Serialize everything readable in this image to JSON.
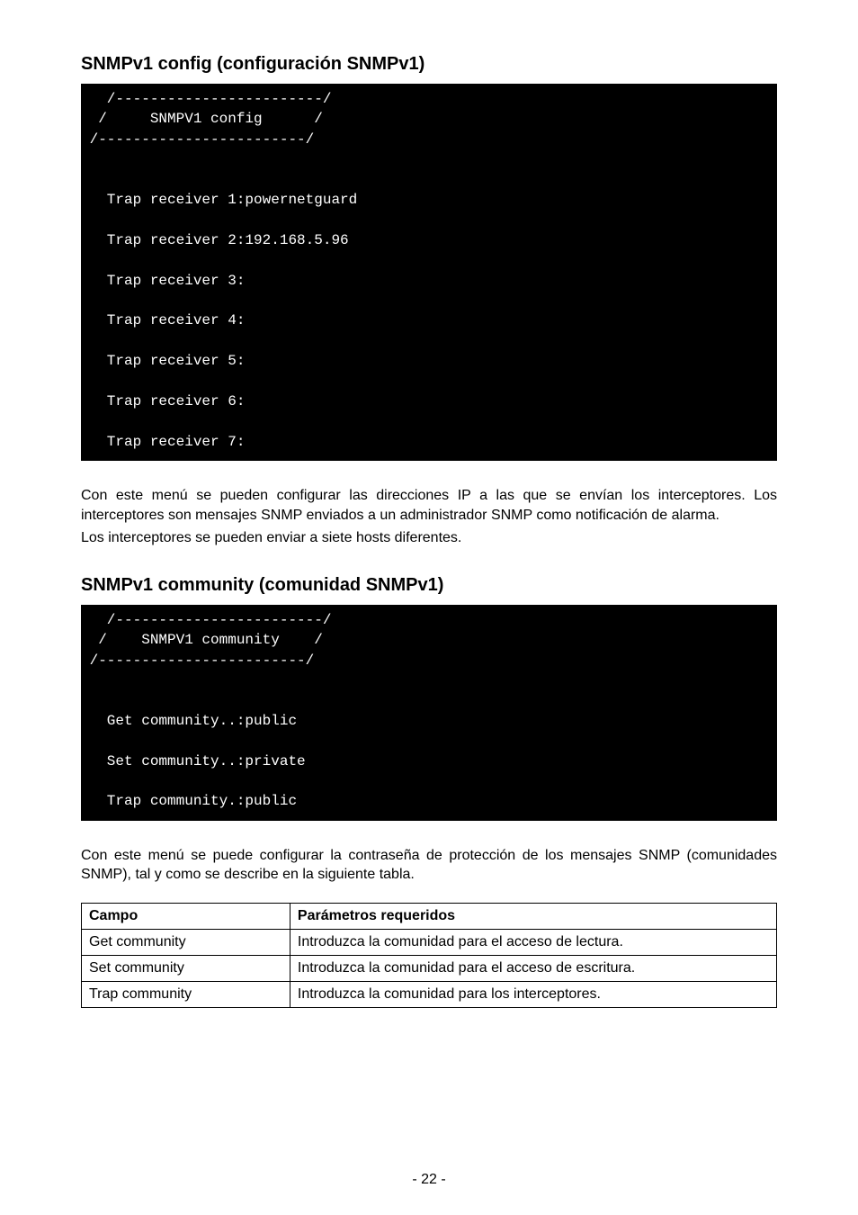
{
  "section1": {
    "heading": "SNMPv1 config (configuración SNMPv1)",
    "terminal": "   /------------------------/\n  /     SNMPV1 config      /\n /------------------------/\n\n\n   Trap receiver 1:powernetguard\n\n   Trap receiver 2:192.168.5.96\n\n   Trap receiver 3:\n\n   Trap receiver 4:\n\n   Trap receiver 5:\n\n   Trap receiver 6:\n\n   Trap receiver 7:",
    "para1": "Con este menú se pueden configurar las direcciones IP a las que se envían los interceptores. Los interceptores son mensajes SNMP enviados a un administrador SNMP como notificación de alarma.",
    "para2": "Los interceptores se pueden enviar a siete hosts diferentes."
  },
  "section2": {
    "heading": "SNMPv1 community (comunidad SNMPv1)",
    "terminal": "   /------------------------/\n  /    SNMPV1 community    /\n /------------------------/\n\n\n   Get community..:public\n\n   Set community..:private\n\n   Trap community.:public",
    "para1": "Con este menú se puede configurar la contraseña de protección de los mensajes SNMP (comunidades SNMP), tal y como se describe en la siguiente tabla."
  },
  "table": {
    "head": {
      "c1": "Campo",
      "c2": "Parámetros requeridos"
    },
    "rows": [
      {
        "c1": "Get community",
        "c2": "Introduzca la comunidad para el acceso de lectura."
      },
      {
        "c1": "Set community",
        "c2": "Introduzca la comunidad para el acceso de escritura."
      },
      {
        "c1": "Trap community",
        "c2": "Introduzca la comunidad para los interceptores."
      }
    ]
  },
  "pagenum": "- 22 -"
}
